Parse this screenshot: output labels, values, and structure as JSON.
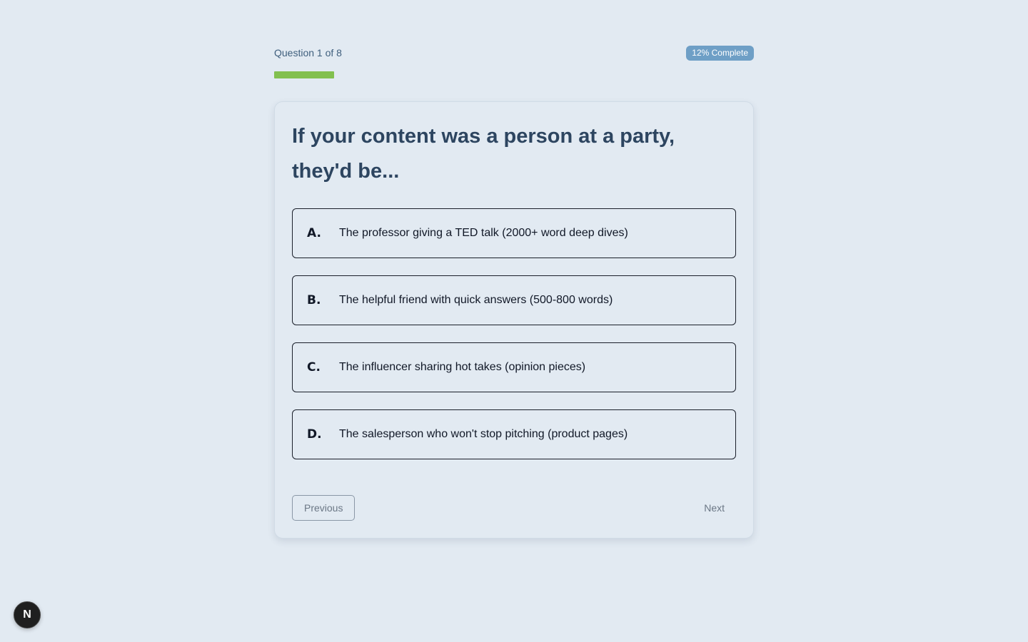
{
  "progress": {
    "counter_label": "Question 1 of 8",
    "badge_label": "12% Complete",
    "fraction": 0.125,
    "fill_color": "#82c04f",
    "badge_color": "#6e9fc6"
  },
  "question": {
    "title": "If your content was a person at a party, they'd be..."
  },
  "options": [
    {
      "letter": "A.",
      "text": "The professor giving a TED talk (2000+ word deep dives)"
    },
    {
      "letter": "B.",
      "text": "The helpful friend with quick answers (500-800 words)"
    },
    {
      "letter": "C.",
      "text": "The influencer sharing hot takes (opinion pieces)"
    },
    {
      "letter": "D.",
      "text": "The salesperson who won't stop pitching (product pages)"
    }
  ],
  "nav": {
    "previous_label": "Previous",
    "next_label": "Next"
  },
  "dev_indicator": {
    "letter": "N",
    "icon": "nextjs-dev-icon"
  }
}
